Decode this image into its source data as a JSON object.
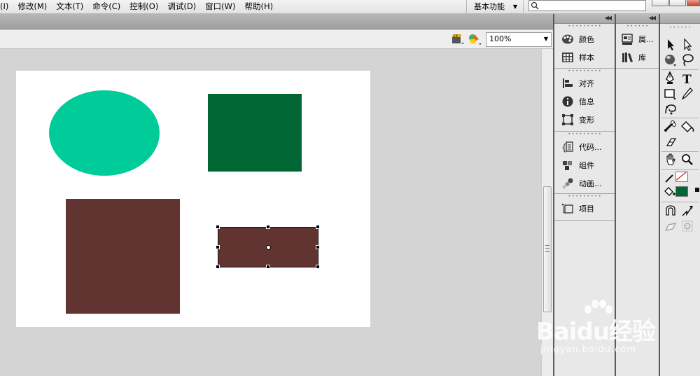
{
  "menubar": {
    "items": [
      "(I)",
      "修改(M)",
      "文本(T)",
      "命令(C)",
      "控制(O)",
      "调试(D)",
      "窗口(W)",
      "帮助(H)"
    ],
    "workspace": "基本功能",
    "search_value": ""
  },
  "editbar": {
    "zoom": "100%"
  },
  "panels": {
    "col1": [
      [
        "颜色",
        "样本"
      ],
      [
        "对齐",
        "信息",
        "变形"
      ],
      [
        "代码...",
        "组件",
        "动画..."
      ],
      [
        "项目"
      ]
    ],
    "col2": [
      "属...",
      "库"
    ]
  },
  "stage": {
    "background": "#ffffff",
    "shapes": [
      {
        "name": "ellipse",
        "fill": "#00cc99"
      },
      {
        "name": "green-rect",
        "fill": "#006633"
      },
      {
        "name": "large-brown-rect",
        "fill": "#613331"
      },
      {
        "name": "selected-rect",
        "fill": "#613331",
        "selected": true
      }
    ]
  },
  "tools": {
    "stroke_color": "none",
    "fill_color": "#006633"
  },
  "watermark": {
    "logo": "Baidu经验",
    "url": "jingyan.baidu.com"
  }
}
